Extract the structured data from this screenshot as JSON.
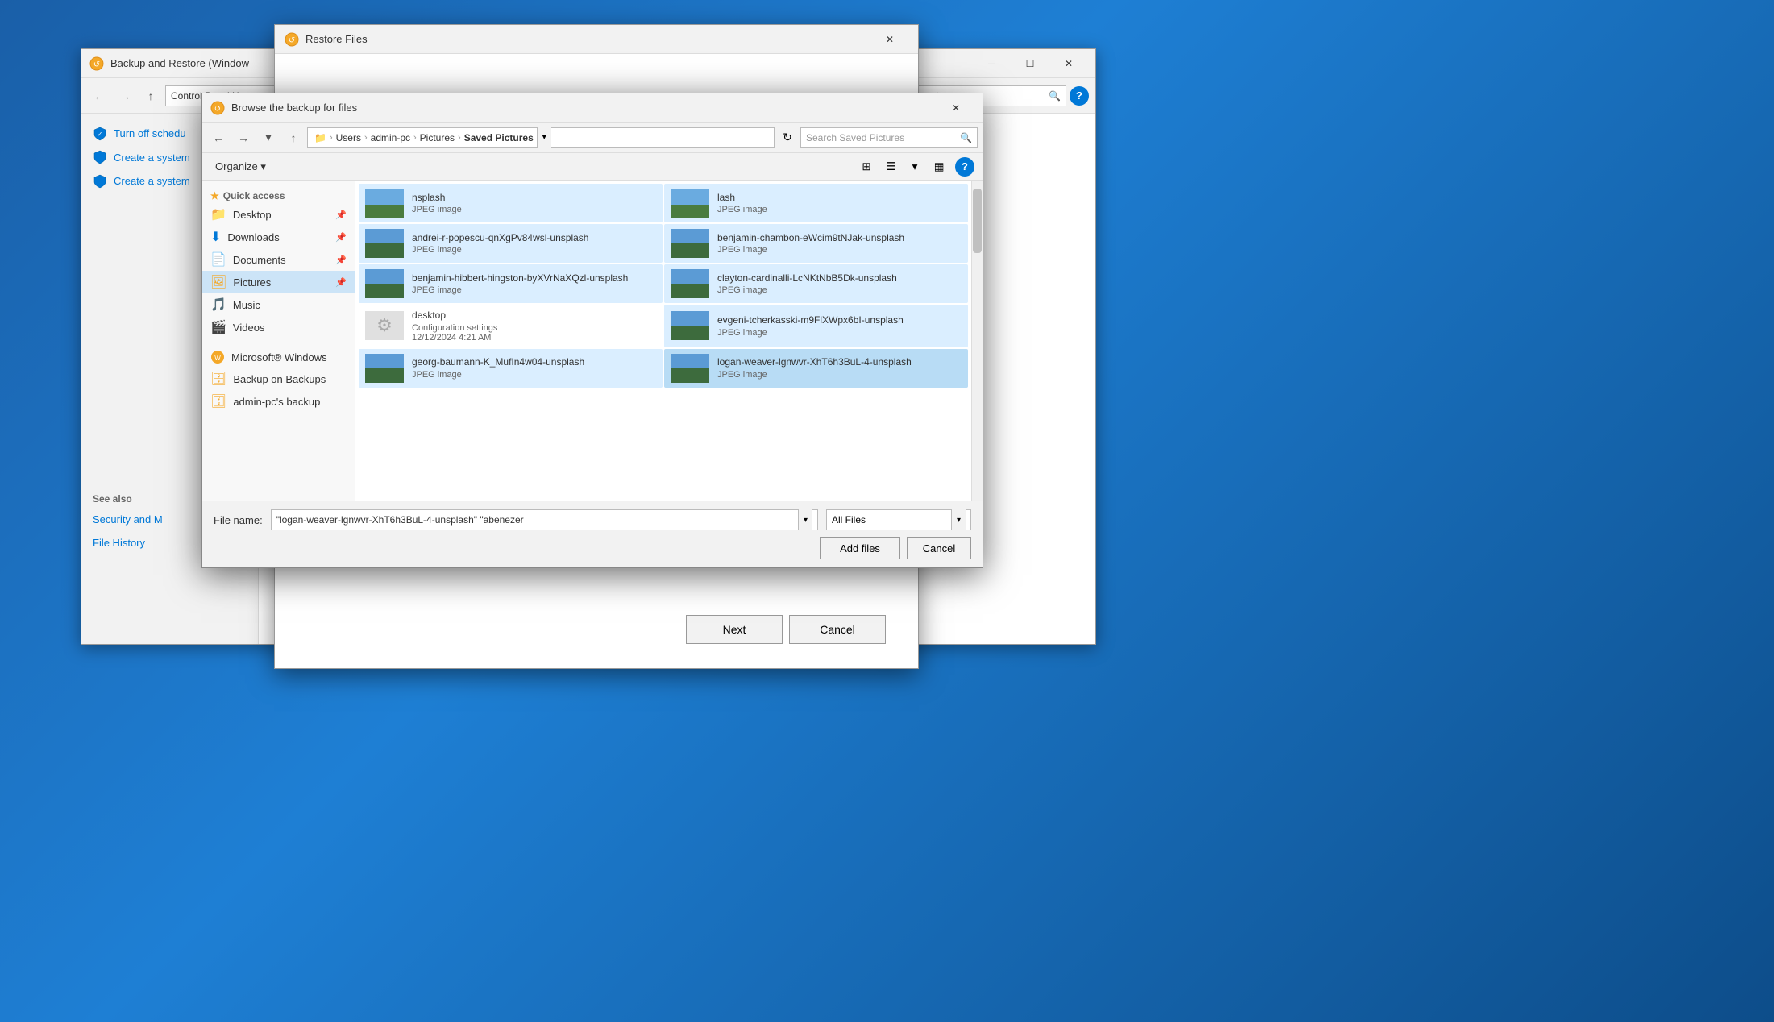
{
  "bg_window": {
    "title": "Backup and Restore (Window",
    "address": "Control Panel H",
    "sidebar_items": [
      {
        "label": "Turn off schedu",
        "icon": "shield"
      },
      {
        "label": "Create a system",
        "icon": "shield"
      },
      {
        "label": "Create a system",
        "icon": "shield"
      }
    ],
    "see_also_label": "See also",
    "see_also_items": [
      {
        "label": "Security and M"
      },
      {
        "label": "File History"
      }
    ]
  },
  "mid_window": {
    "title": "Restore Files",
    "next_label": "Next",
    "cancel_label": "Cancel"
  },
  "browse_dialog": {
    "title": "Browse the backup for files",
    "breadcrumb": {
      "users": "Users",
      "admin_pc": "admin-pc",
      "pictures": "Pictures",
      "saved": "Saved Pictures"
    },
    "search_placeholder": "Search Saved Pictures",
    "toolbar": {
      "organize_label": "Organize ▾"
    },
    "sidebar": {
      "quick_access_label": "Quick access",
      "items": [
        {
          "label": "Desktop",
          "pinned": true
        },
        {
          "label": "Downloads",
          "pinned": true
        },
        {
          "label": "Documents",
          "pinned": true
        },
        {
          "label": "Pictures",
          "pinned": true
        },
        {
          "label": "Music"
        },
        {
          "label": "Videos"
        }
      ],
      "network_label": "Microsoft® Windows",
      "network_items": [
        {
          "label": "Backup on Backups"
        },
        {
          "label": "admin-pc's backup"
        }
      ]
    },
    "files": [
      {
        "name": "nsplash",
        "type": "JPEG image",
        "row": 0,
        "col": 0,
        "has_thumb": true
      },
      {
        "name": "lash",
        "type": "JPEG image",
        "row": 0,
        "col": 1,
        "has_thumb": true
      },
      {
        "name": "andrei-r-popescu-qnXgPv84wsl-unsplash",
        "type": "JPEG image",
        "row": 1,
        "col": 0,
        "has_thumb": true
      },
      {
        "name": "benjamin-chambon-eWcim9tNJak-unsplash",
        "type": "JPEG image",
        "row": 1,
        "col": 1,
        "has_thumb": true
      },
      {
        "name": "benjamin-hibbert-hingston-byXVrNaXQzl-unsplash",
        "type": "JPEG image",
        "row": 2,
        "col": 0,
        "has_thumb": true
      },
      {
        "name": "clayton-cardinalli-LcNKtNbB5Dk-unsplash",
        "type": "JPEG image",
        "row": 2,
        "col": 1,
        "has_thumb": true
      },
      {
        "name": "desktop",
        "type": "Configuration settings",
        "date": "12/12/2024 4:21 AM",
        "row": 3,
        "col": 0,
        "is_config": true
      },
      {
        "name": "evgeni-tcherkasski-m9FlXWpx6bI-unsplash",
        "type": "JPEG image",
        "row": 3,
        "col": 1,
        "has_thumb": true
      },
      {
        "name": "georg-baumann-K_MufIn4w04-unsplash",
        "type": "JPEG image",
        "row": 4,
        "col": 0,
        "has_thumb": true
      },
      {
        "name": "logan-weaver-lgnwvr-XhT6h3BuL-4-unsplash",
        "type": "JPEG image",
        "row": 4,
        "col": 1,
        "has_thumb": true,
        "selected": true
      }
    ],
    "filename_label": "File name:",
    "filename_value": "\"logan-weaver-lgnwvr-XhT6h3BuL-4-unsplash\" \"abenezer",
    "filetype_label": "All Files",
    "add_files_label": "Add files",
    "cancel_label": "Cancel"
  }
}
